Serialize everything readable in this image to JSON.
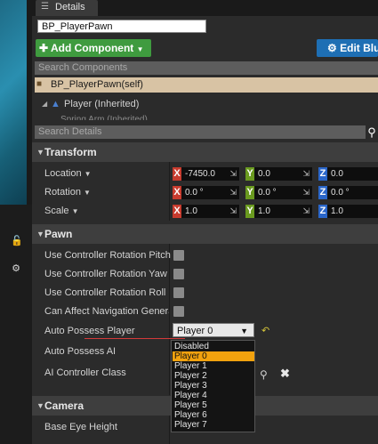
{
  "tab": {
    "label": "Details",
    "icon": "details-icon"
  },
  "name_field": {
    "value": "BP_PlayerPawn"
  },
  "toolbar": {
    "add_component": "Add Component",
    "edit_blueprint": "Edit Blu"
  },
  "search_components": {
    "placeholder": "Search Components"
  },
  "components": {
    "self": "BP_PlayerPawn(self)",
    "player": "Player (Inherited)",
    "partial_row": "Spring Arm (Inherited)"
  },
  "search_details": {
    "placeholder": "Search Details"
  },
  "transform": {
    "title": "Transform",
    "location": {
      "label": "Location",
      "x": "-7450.0",
      "y": "0.0",
      "z": "0.0"
    },
    "rotation": {
      "label": "Rotation",
      "x": "0.0 °",
      "y": "0.0 °",
      "z": "0.0 °"
    },
    "scale": {
      "label": "Scale",
      "x": "1.0",
      "y": "1.0",
      "z": "1.0"
    },
    "axis_labels": {
      "x": "X",
      "y": "Y",
      "z": "Z"
    },
    "axis_colors": {
      "x": "#c83b2e",
      "y": "#6a9a1f",
      "z": "#2a66c9"
    }
  },
  "pawn": {
    "title": "Pawn",
    "use_controller_rotation_pitch": "Use Controller Rotation Pitch",
    "use_controller_rotation_yaw": "Use Controller Rotation Yaw",
    "use_controller_rotation_roll": "Use Controller Rotation Roll",
    "can_affect_navigation": "Can Affect Navigation Generation",
    "auto_possess_player": {
      "label": "Auto Possess Player",
      "value": "Player 0"
    },
    "auto_possess_ai": "Auto Possess AI",
    "ai_controller_class": "AI Controller Class",
    "options": [
      "Disabled",
      "Player 0",
      "Player 1",
      "Player 2",
      "Player 3",
      "Player 4",
      "Player 5",
      "Player 6",
      "Player 7"
    ],
    "selected_option": "Player 0"
  },
  "camera": {
    "title": "Camera",
    "base_eye_height": "Base Eye Height"
  },
  "colors": {
    "accent_green": "#3f9b3f",
    "accent_blue": "#1e6fb4",
    "selection_orange": "#f2a20e",
    "self_row": "#d8c3a4"
  }
}
